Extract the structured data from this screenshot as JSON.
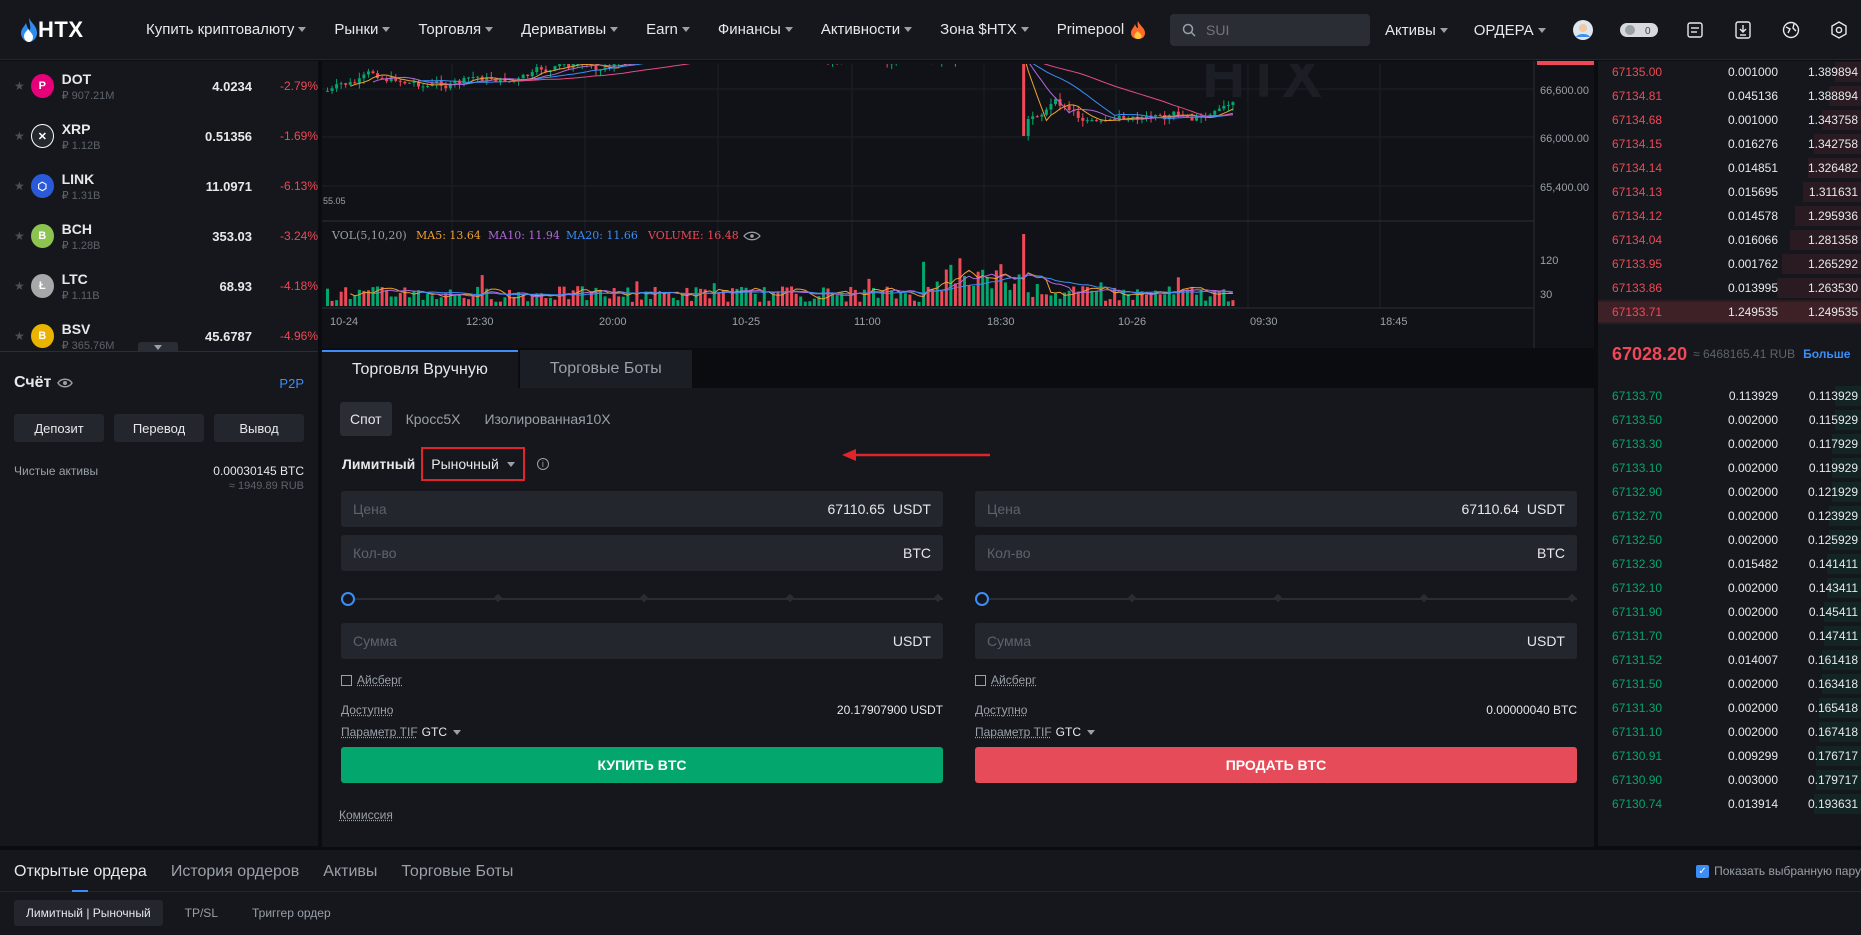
{
  "nav": {
    "logo": "HTX",
    "items": [
      "Купить криптовалюту",
      "Рынки",
      "Торговля",
      "Деривативы",
      "Earn",
      "Финансы",
      "Активности",
      "Зона $HTX",
      "Primepool"
    ],
    "search_placeholder": "SUI",
    "assets": "Активы",
    "orders": "ОРДЕРА"
  },
  "coins": [
    {
      "sym": "DOT",
      "cap": "₽ 907.21M",
      "price": "4.0234",
      "chg": "-2.79%",
      "color": "#e6007a",
      "glyph": "P"
    },
    {
      "sym": "XRP",
      "cap": "₽ 1.12B",
      "price": "0.51356",
      "chg": "-1.69%",
      "color": "#23292f",
      "glyph": "✕"
    },
    {
      "sym": "LINK",
      "cap": "₽ 1.31B",
      "price": "11.0971",
      "chg": "-6.13%",
      "color": "#2a5ada",
      "glyph": "⬡"
    },
    {
      "sym": "BCH",
      "cap": "₽ 1.28B",
      "price": "353.03",
      "chg": "-3.24%",
      "color": "#8dc351",
      "glyph": "B"
    },
    {
      "sym": "LTC",
      "cap": "₽ 1.11B",
      "price": "68.93",
      "chg": "-4.18%",
      "color": "#a6a9aa",
      "glyph": "Ł"
    },
    {
      "sym": "BSV",
      "cap": "₽ 365.76M",
      "price": "45.6787",
      "chg": "-4.96%",
      "color": "#eab300",
      "glyph": "B"
    }
  ],
  "account": {
    "title": "Счёт",
    "p2p": "P2P",
    "buttons": [
      "Депозит",
      "Перевод",
      "Вывод"
    ],
    "net_label": "Чистые активы",
    "net_btc": "0.00030145 BTC",
    "net_rub": "≈ 1949.89 RUB"
  },
  "chart": {
    "price_ticks": [
      "66,600.00",
      "66,000.00",
      "65,400.00"
    ],
    "left_tick": "55.05",
    "vol_legend": {
      "label": "VOL(5,10,20)",
      "ma5": "MA5: 13.64",
      "ma10": "MA10: 11.94",
      "ma20": "MA20: 11.66",
      "volume": "VOLUME: 16.48"
    },
    "vol_ticks": [
      "120",
      "30"
    ],
    "time_ticks": [
      "10-24",
      "12:30",
      "20:00",
      "10-25",
      "11:00",
      "18:30",
      "10-26",
      "09:30",
      "18:45"
    ],
    "watermark": "HTX"
  },
  "trade": {
    "tabs": [
      "Торговля Вручную",
      "Торговые Боты"
    ],
    "sub_tabs": [
      "Спот",
      "Кросс5X",
      "Изолированная10X"
    ],
    "order_limit": "Лимитный",
    "order_market": "Рыночный",
    "buy": {
      "price_ph": "Цена",
      "price_val": "67110.65",
      "price_unit": "USDT",
      "qty_ph": "Кол-во",
      "qty_unit": "BTC",
      "sum_ph": "Сумма",
      "sum_unit": "USDT",
      "iceberg": "Айсберг",
      "avail_label": "Доступно",
      "avail_val": "20.17907900 USDT",
      "tif_label": "Параметр TIF",
      "tif_val": "GTC",
      "btn": "КУПИТЬ BTC"
    },
    "sell": {
      "price_ph": "Цена",
      "price_val": "67110.64",
      "price_unit": "USDT",
      "qty_ph": "Кол-во",
      "qty_unit": "BTC",
      "sum_ph": "Сумма",
      "sum_unit": "USDT",
      "iceberg": "Айсберг",
      "avail_label": "Доступно",
      "avail_val": "0.00000040 BTC",
      "tif_label": "Параметр TIF",
      "tif_val": "GTC",
      "btn": "ПРОДАТЬ BTC"
    },
    "commission": "Комиссия"
  },
  "book": {
    "asks": [
      {
        "p": "67135.00",
        "a": "0.001000",
        "t": "1.389894",
        "d": 0.1
      },
      {
        "p": "67134.81",
        "a": "0.045136",
        "t": "1.388894",
        "d": 0.12
      },
      {
        "p": "67134.68",
        "a": "0.001000",
        "t": "1.343758",
        "d": 0.15
      },
      {
        "p": "67134.15",
        "a": "0.016276",
        "t": "1.342758",
        "d": 0.18
      },
      {
        "p": "67134.14",
        "a": "0.014851",
        "t": "1.326482",
        "d": 0.2
      },
      {
        "p": "67134.13",
        "a": "0.015695",
        "t": "1.311631",
        "d": 0.22
      },
      {
        "p": "67134.12",
        "a": "0.014578",
        "t": "1.295936",
        "d": 0.25
      },
      {
        "p": "67134.04",
        "a": "0.016066",
        "t": "1.281358",
        "d": 0.27
      },
      {
        "p": "67133.95",
        "a": "0.001762",
        "t": "1.265292",
        "d": 0.3
      },
      {
        "p": "67133.86",
        "a": "0.013995",
        "t": "1.263530",
        "d": 0.32
      },
      {
        "p": "67133.71",
        "a": "1.249535",
        "t": "1.249535",
        "d": 1.0
      }
    ],
    "mid_price": "67028.20",
    "mid_rub": "≈ 6468165.41 RUB",
    "mid_more": "Больше",
    "bids": [
      {
        "p": "67133.70",
        "a": "0.113929",
        "t": "0.113929",
        "d": 0.1
      },
      {
        "p": "67133.50",
        "a": "0.002000",
        "t": "0.115929",
        "d": 0.1
      },
      {
        "p": "67133.30",
        "a": "0.002000",
        "t": "0.117929",
        "d": 0.11
      },
      {
        "p": "67133.10",
        "a": "0.002000",
        "t": "0.119929",
        "d": 0.11
      },
      {
        "p": "67132.90",
        "a": "0.002000",
        "t": "0.121929",
        "d": 0.11
      },
      {
        "p": "67132.70",
        "a": "0.002000",
        "t": "0.123929",
        "d": 0.12
      },
      {
        "p": "67132.50",
        "a": "0.002000",
        "t": "0.125929",
        "d": 0.12
      },
      {
        "p": "67132.30",
        "a": "0.015482",
        "t": "0.141411",
        "d": 0.13
      },
      {
        "p": "67132.10",
        "a": "0.002000",
        "t": "0.143411",
        "d": 0.13
      },
      {
        "p": "67131.90",
        "a": "0.002000",
        "t": "0.145411",
        "d": 0.14
      },
      {
        "p": "67131.70",
        "a": "0.002000",
        "t": "0.147411",
        "d": 0.14
      },
      {
        "p": "67131.52",
        "a": "0.014007",
        "t": "0.161418",
        "d": 0.15
      },
      {
        "p": "67131.50",
        "a": "0.002000",
        "t": "0.163418",
        "d": 0.15
      },
      {
        "p": "67131.30",
        "a": "0.002000",
        "t": "0.165418",
        "d": 0.16
      },
      {
        "p": "67131.10",
        "a": "0.002000",
        "t": "0.167418",
        "d": 0.16
      },
      {
        "p": "67130.91",
        "a": "0.009299",
        "t": "0.176717",
        "d": 0.17
      },
      {
        "p": "67130.90",
        "a": "0.003000",
        "t": "0.179717",
        "d": 0.17
      },
      {
        "p": "67130.74",
        "a": "0.013914",
        "t": "0.193631",
        "d": 0.18
      }
    ]
  },
  "bottom": {
    "tabs": [
      "Открытые ордера",
      "История ордеров",
      "Активы",
      "Торговые Боты"
    ],
    "show_pair": "Показать выбранную пару",
    "sub_tabs": [
      "Лимитный | Рыночный",
      "TP/SL",
      "Триггер ордер"
    ]
  },
  "colors": {
    "up": "#03a66d",
    "down": "#f04856",
    "accent": "#3b8ef7",
    "highlight": "#e0242c"
  }
}
